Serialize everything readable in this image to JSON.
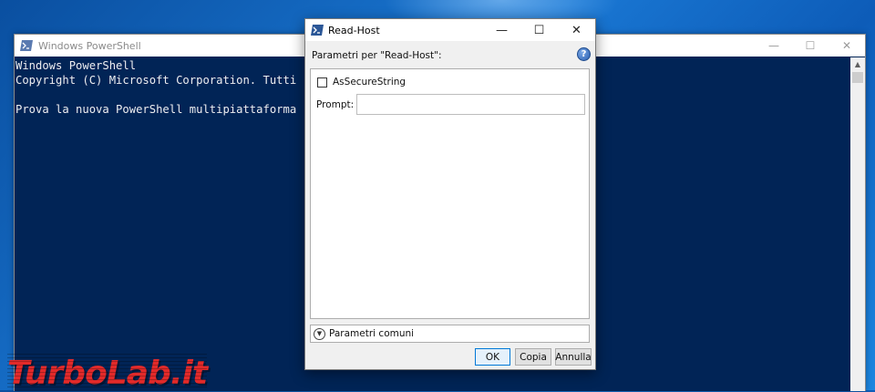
{
  "powershell_window": {
    "title": "Windows PowerShell",
    "console_lines": [
      "Windows PowerShell",
      "Copyright (C) Microsoft Corporation. Tutti",
      "",
      "Prova la nuova PowerShell multipiattaforma"
    ],
    "controls": {
      "minimize": "—",
      "maximize": "☐",
      "close": "✕"
    }
  },
  "dialog": {
    "title": "Read-Host",
    "params_header": "Parametri per \"Read-Host\":",
    "help_symbol": "?",
    "checkbox_label": "AsSecureString",
    "checkbox_checked": false,
    "prompt_label": "Prompt:",
    "prompt_value": "",
    "common_params_label": "Parametri comuni",
    "buttons": {
      "ok": "OK",
      "copy": "Copia",
      "cancel": "Annulla"
    },
    "controls": {
      "minimize": "—",
      "maximize": "☐",
      "close": "✕"
    }
  },
  "watermark": {
    "part1": "Turbo",
    "part2": "Lab.it"
  },
  "colors": {
    "console_bg": "#012456",
    "console_text": "#eeedf0",
    "desktop": "#1a78d4",
    "watermark": "#e22a2a",
    "ok_border": "#0078d7"
  }
}
